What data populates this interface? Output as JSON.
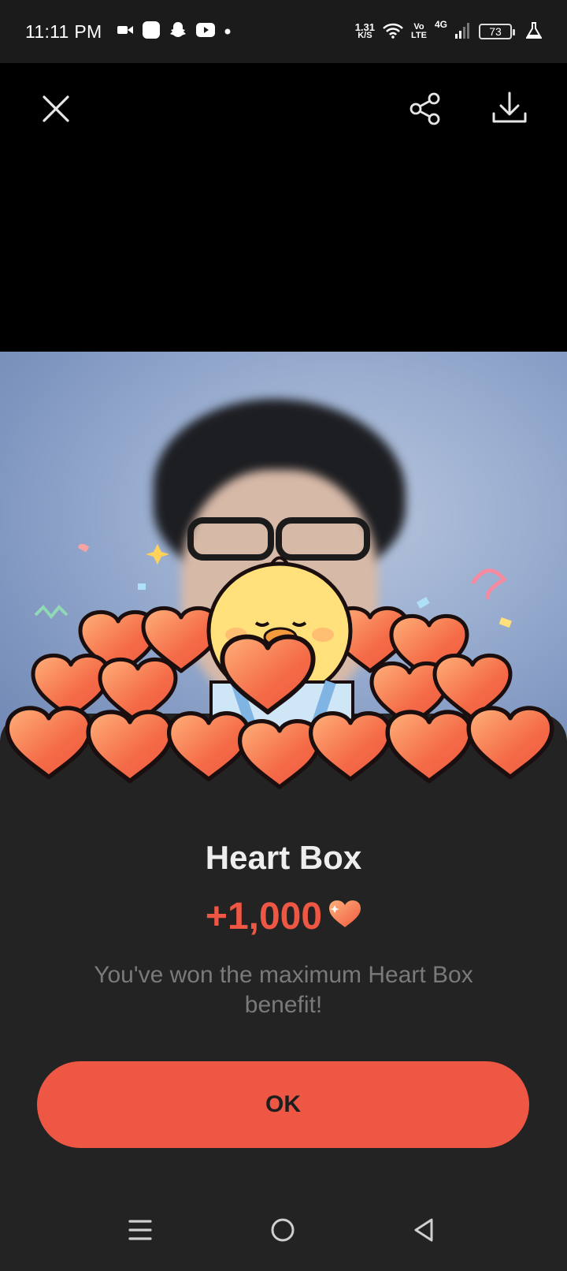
{
  "status_bar": {
    "time": "11:11 PM",
    "net_speed_value": "1.31",
    "net_speed_unit": "K/S",
    "volte_top": "Vo",
    "volte_bottom": "LTE",
    "network": "4G",
    "battery": "73",
    "left_icons": [
      "video-camera-icon",
      "app-icon",
      "snapchat-icon",
      "youtube-icon",
      "dot-icon"
    ],
    "right_icons": [
      "wifi-icon",
      "signal-icon",
      "lab-flask-icon"
    ]
  },
  "toolbar": {
    "icons": [
      "close-icon",
      "share-icon",
      "download-icon"
    ]
  },
  "dialog": {
    "title": "Heart Box",
    "reward_amount": "+1,000",
    "reward_icon": "heart-icon",
    "message": "You've won the maximum Heart Box benefit!",
    "ok_label": "OK"
  },
  "nav_bar": {
    "icons": [
      "menu-icon",
      "home-circle-icon",
      "back-triangle-icon"
    ]
  },
  "colors": {
    "accent": "#ee5744",
    "sheet_bg": "#232323",
    "heart": "#f26b45"
  }
}
